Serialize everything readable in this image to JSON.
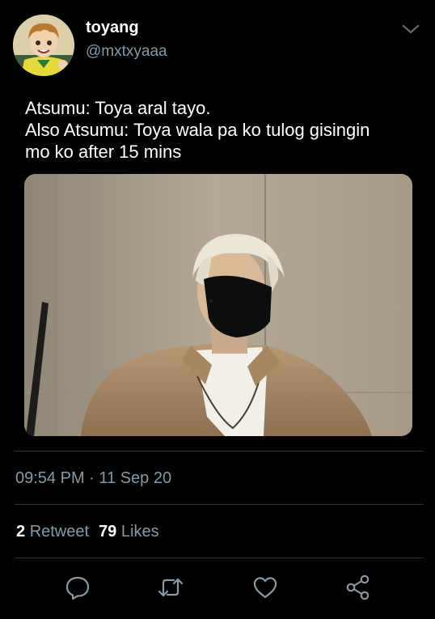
{
  "author": {
    "display_name": "toyang",
    "handle": "@mxtxyaaa"
  },
  "tweet": {
    "lines": [
      "Atsumu: Toya aral tayo.",
      "Also Atsumu: Toya wala pa ko tulog gisingin",
      "mo ko after 15 mins"
    ],
    "timestamp": "09:54 PM · 11 Sep 20"
  },
  "stats": {
    "retweets_count": "2",
    "retweets_label": "Retweet",
    "likes_count": "79",
    "likes_label": "Likes"
  },
  "icons": {
    "more": "chevron-down-icon",
    "reply": "comment-icon",
    "retweet": "retweet-icon",
    "like": "heart-icon",
    "share": "share-icon"
  },
  "colors": {
    "background": "#000000",
    "primary_text": "#ffffff",
    "secondary_text": "#8899a6",
    "divider": "#2f3336"
  }
}
